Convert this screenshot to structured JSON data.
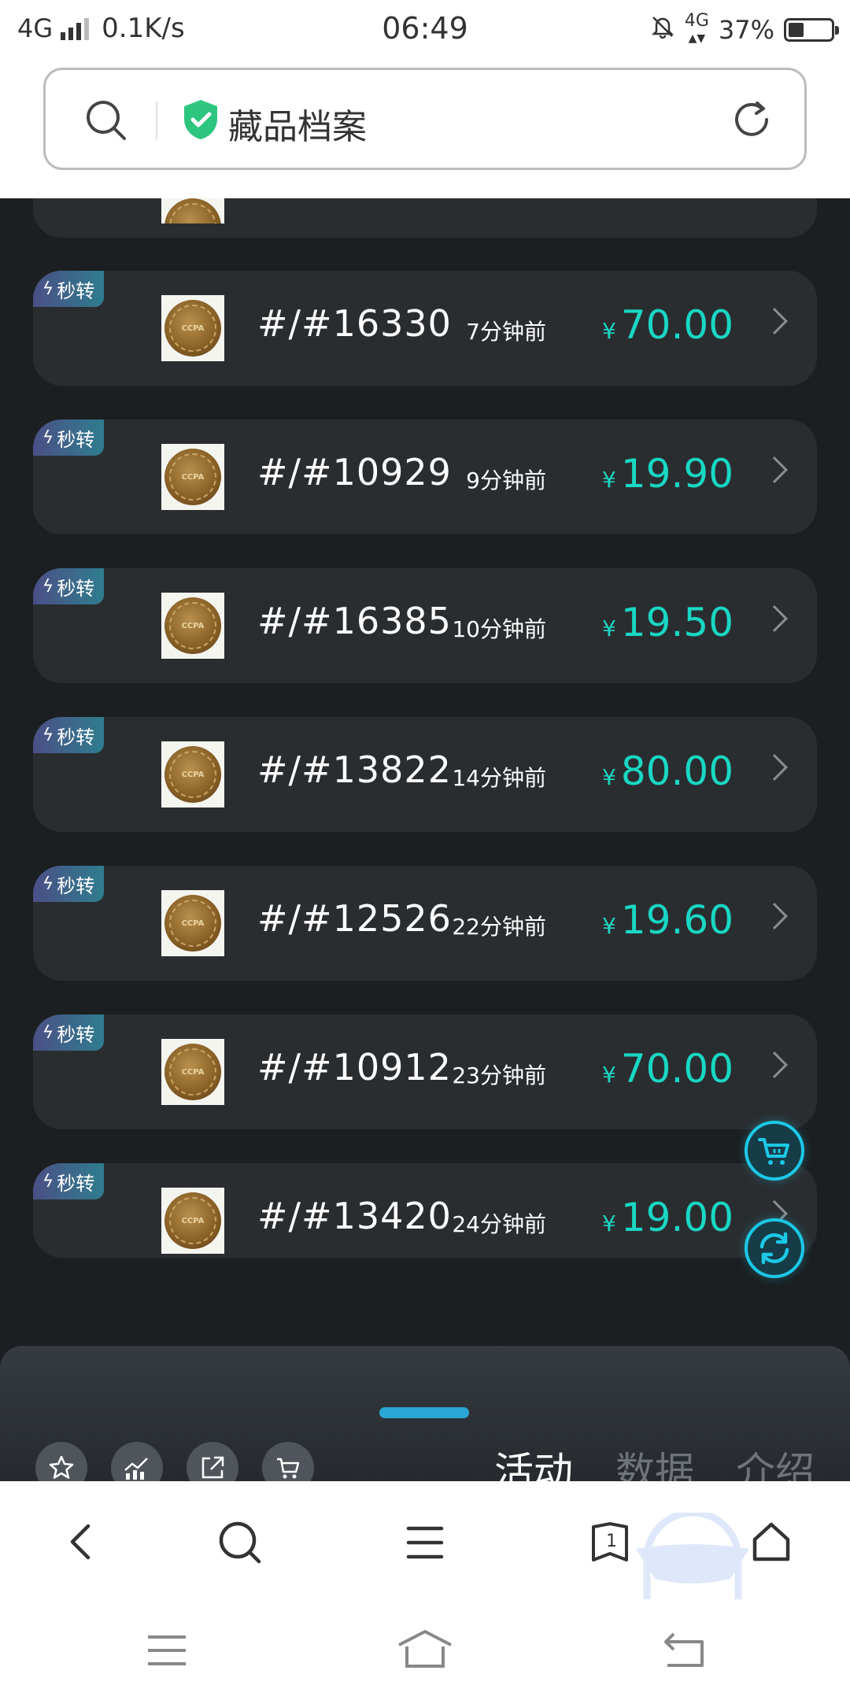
{
  "status_bar": {
    "network": "4G",
    "speed": "0.1K/s",
    "time": "06:49",
    "network2": "4G",
    "battery": "37%",
    "battery_level": 0.37
  },
  "address_bar": {
    "title": "藏品档案",
    "icons": [
      "search-icon",
      "shield-check-icon",
      "refresh-icon"
    ],
    "shield_color": "#2ec57f"
  },
  "colors": {
    "background": "#1c1f21",
    "card": "#2a2d30",
    "price": "#19d7c4",
    "tag_gradient": [
      "#4b4f86",
      "#2f7d8e"
    ],
    "accent": "#1cc8e6"
  },
  "listings": [
    {
      "tag": "秒转",
      "id": "#/#16330",
      "time": "7分钟前",
      "currency": "¥",
      "price": "70.00"
    },
    {
      "tag": "秒转",
      "id": "#/#10929",
      "time": "9分钟前",
      "currency": "¥",
      "price": "19.90"
    },
    {
      "tag": "秒转",
      "id": "#/#16385",
      "time": "10分钟前",
      "currency": "¥",
      "price": "19.50"
    },
    {
      "tag": "秒转",
      "id": "#/#13822",
      "time": "14分钟前",
      "currency": "¥",
      "price": "80.00"
    },
    {
      "tag": "秒转",
      "id": "#/#12526",
      "time": "22分钟前",
      "currency": "¥",
      "price": "19.60"
    },
    {
      "tag": "秒转",
      "id": "#/#10912",
      "time": "23分钟前",
      "currency": "¥",
      "price": "70.00"
    },
    {
      "tag": "秒转",
      "id": "#/#13420",
      "time": "24分钟前",
      "currency": "¥",
      "price": "19.00"
    }
  ],
  "floating_buttons": [
    "cart-icon",
    "refresh-swap-icon"
  ],
  "sheet": {
    "actions": [
      "star-icon",
      "chart-icon",
      "share-icon",
      "cart-icon"
    ],
    "tabs": [
      {
        "label": "活动",
        "active": true
      },
      {
        "label": "数据",
        "active": false
      },
      {
        "label": "介绍",
        "active": false
      }
    ]
  },
  "browser_bar": {
    "icons": [
      "back-icon",
      "search-icon",
      "menu-icon",
      "tabs-icon",
      "home-icon"
    ],
    "tab_count": "1"
  },
  "system_nav": {
    "icons": [
      "recent-apps-icon",
      "home-icon",
      "back-icon"
    ]
  }
}
